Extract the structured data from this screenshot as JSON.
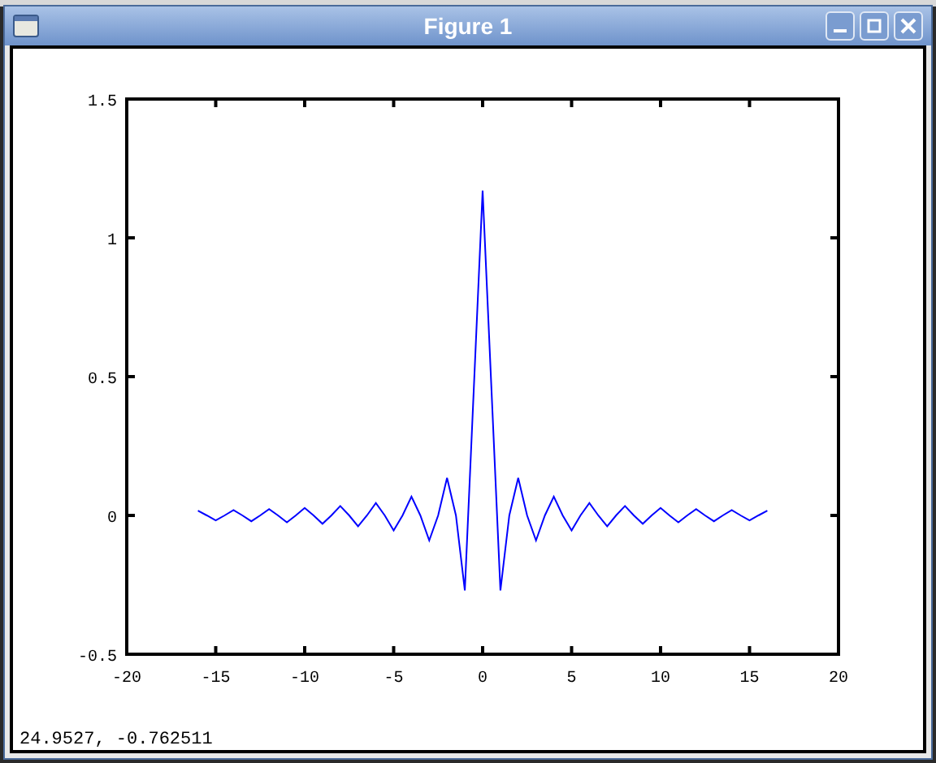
{
  "window": {
    "title": "Figure 1"
  },
  "plot": {
    "chart_data": {
      "type": "line",
      "xlim": [
        -20,
        20
      ],
      "ylim": [
        -0.5,
        1.5
      ],
      "xticks": [
        -20,
        -15,
        -10,
        -5,
        0,
        5,
        10,
        15,
        20
      ],
      "yticks": [
        -0.5,
        0,
        0.5,
        1,
        1.5
      ],
      "x": [
        -16,
        -15.5,
        -15,
        -14.5,
        -14,
        -13.5,
        -13,
        -12.5,
        -12,
        -11.5,
        -11,
        -10.5,
        -10,
        -9.5,
        -9,
        -8.5,
        -8,
        -7.5,
        -7,
        -6.5,
        -6,
        -5.5,
        -5,
        -4.5,
        -4,
        -3.5,
        -3,
        -2.5,
        -2,
        -1.5,
        -1,
        -0.5,
        0,
        0.5,
        1,
        1.5,
        2,
        2.5,
        3,
        3.5,
        4,
        4.5,
        5,
        5.5,
        6,
        6.5,
        7,
        7.5,
        8,
        8.5,
        9,
        9.5,
        10,
        10.5,
        11,
        11.5,
        12,
        12.5,
        13,
        13.5,
        14,
        14.5,
        15,
        15.5,
        16
      ],
      "series": [
        {
          "color": "#0000ff",
          "values": [
            0.017,
            0,
            -0.018,
            0,
            0.019,
            0,
            -0.021,
            0,
            0.023,
            0,
            -0.025,
            0,
            0.027,
            0,
            -0.03,
            0,
            0.034,
            0,
            -0.039,
            0,
            0.045,
            0,
            -0.054,
            0,
            0.068,
            0,
            -0.09,
            0,
            0.135,
            0,
            -0.27,
            0.45,
            1.17,
            0.45,
            -0.27,
            0,
            0.135,
            0,
            -0.09,
            0,
            0.068,
            0,
            -0.054,
            0,
            0.045,
            0,
            -0.039,
            0,
            0.034,
            0,
            -0.03,
            0,
            0.027,
            0,
            -0.025,
            0,
            0.023,
            0,
            -0.021,
            0,
            0.019,
            0,
            -0.018,
            0,
            0.017
          ]
        }
      ]
    }
  },
  "status_bar": {
    "text": "24.9527, -0.762511"
  }
}
